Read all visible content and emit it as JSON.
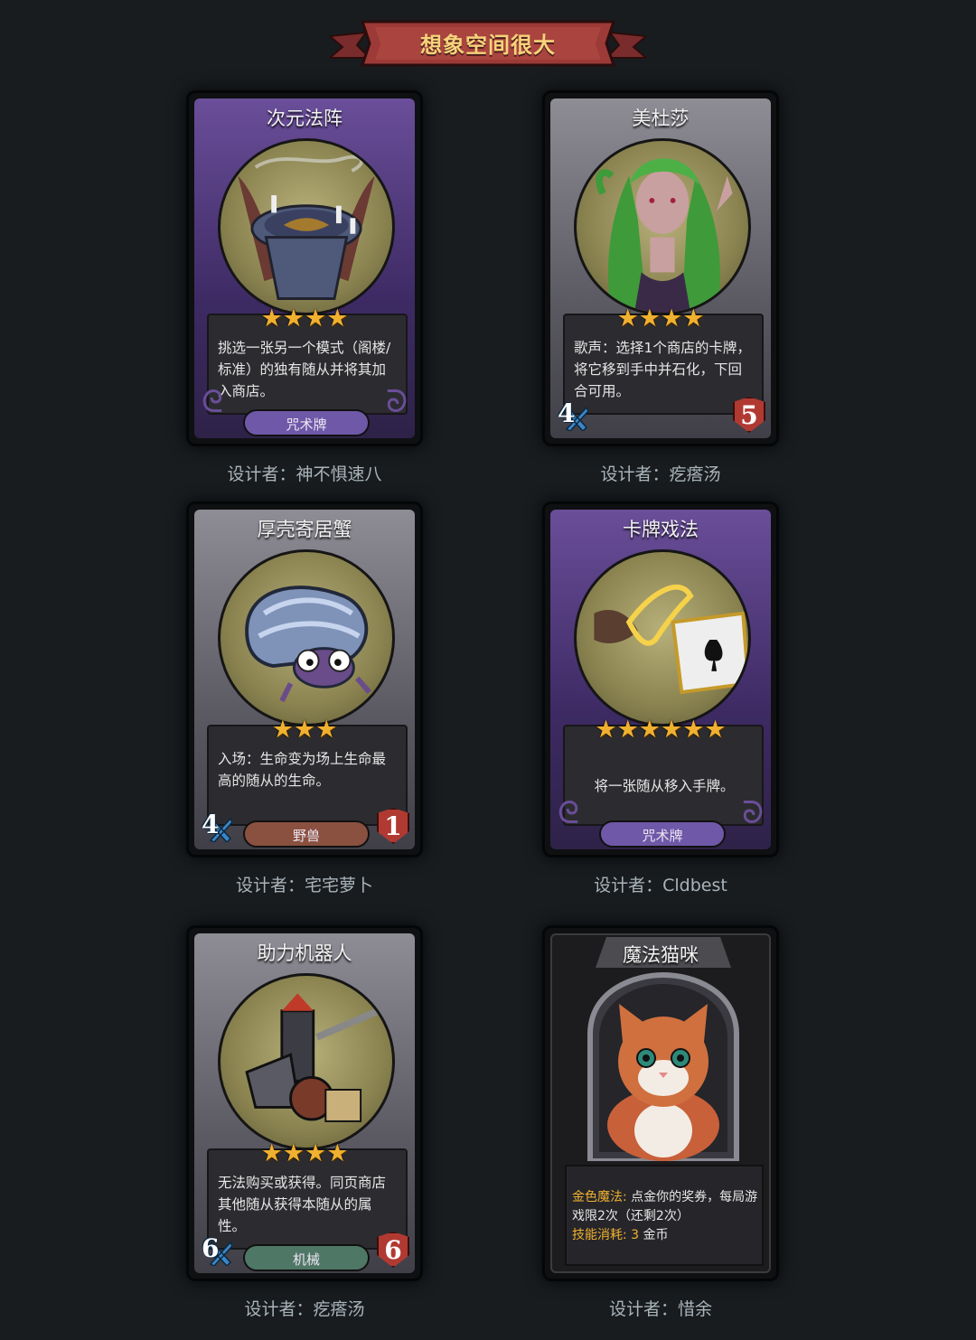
{
  "banner": {
    "title": "想象空间很大"
  },
  "cards": [
    {
      "name": "次元法阵",
      "stars": "★★★★",
      "desc": "挑选一张另一个模式（阁楼/标准）的独有随从并将其加入商店。",
      "tag": "咒术牌",
      "designer": "设计者：神不惧速八"
    },
    {
      "name": "美杜莎",
      "stars": "★★★★",
      "desc": "歌声：选择1个商店的卡牌，将它移到手中并石化，下回合可用。",
      "attack": "4",
      "health": "5",
      "designer": "设计者：疙瘩汤"
    },
    {
      "name": "厚壳寄居蟹",
      "stars": "★★★",
      "desc": "入场：生命变为场上生命最高的随从的生命。",
      "tag": "野兽",
      "attack": "4",
      "health": "1",
      "designer": "设计者：宅宅萝卜"
    },
    {
      "name": "卡牌戏法",
      "stars": "★★★★★★",
      "desc": "将一张随从移入手牌。",
      "tag": "咒术牌",
      "designer": "设计者：Cldbest"
    },
    {
      "name": "助力机器人",
      "stars": "★★★★",
      "desc": "无法购买或获得。同页商店其他随从获得本随从的属性。",
      "tag": "机械",
      "attack": "6",
      "health": "6",
      "designer": "设计者：疙瘩汤"
    },
    {
      "name": "魔法猫咪",
      "skill_label": "金色魔法:",
      "skill_text": "点金你的奖券，每局游戏限2次（还剩2次）",
      "cost_label": "技能消耗:",
      "cost_value": "3",
      "cost_unit": "金币",
      "designer": "设计者：惜余"
    }
  ]
}
